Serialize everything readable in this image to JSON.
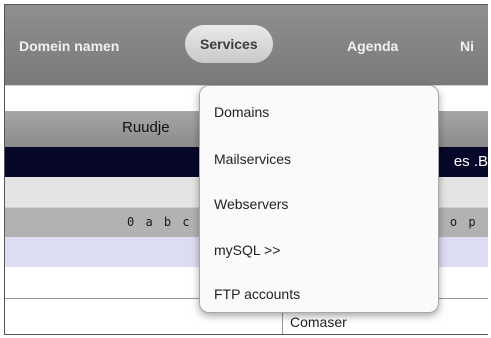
{
  "nav": {
    "items": [
      {
        "label": "Domein namen"
      },
      {
        "label": "Services",
        "active": true
      },
      {
        "label": "Agenda"
      },
      {
        "label": "Ni"
      }
    ]
  },
  "dropdown": {
    "items": [
      {
        "label": "Domains"
      },
      {
        "label": "Mailservices"
      },
      {
        "label": "Webservers"
      },
      {
        "label": "mySQL >>"
      },
      {
        "label": "FTP accounts"
      }
    ]
  },
  "table": {
    "title_partial": "Ruudje",
    "header_partial": "es .BE",
    "letters_left": "0 a b c",
    "letters_right": "o p c",
    "cell_partial": "Comaser"
  },
  "colors": {
    "nav_bg": "#868686",
    "dark_row": "#07072a",
    "lavender_row": "#dcdcf3"
  }
}
